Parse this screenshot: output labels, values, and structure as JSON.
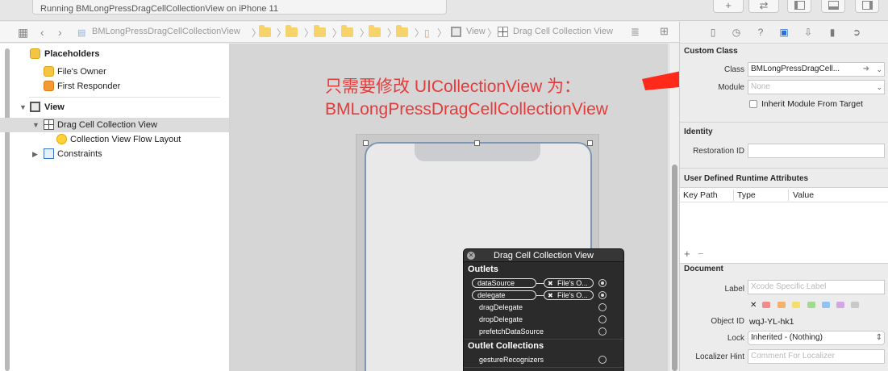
{
  "toolbar": {
    "activity_text": "Running BMLongPressDragCellCollectionView on iPhone 11",
    "add_icon": "+",
    "swap_icon": "⇄"
  },
  "jumpbar": {
    "project": "BMLongPressDragCellCollectionView",
    "view": "View",
    "collection": "Drag Cell Collection View"
  },
  "outline": {
    "placeholders": "Placeholders",
    "files_owner": "File's Owner",
    "first_responder": "First Responder",
    "view": "View",
    "drag_cell_collection_view": "Drag Cell Collection View",
    "flow_layout": "Collection View Flow Layout",
    "constraints": "Constraints"
  },
  "annotation": {
    "line1": "只需要修改 UICollectionView 为：",
    "line2": "BMLongPressDragCellCollectionView",
    "color": "#e53b3b"
  },
  "popup": {
    "title": "Drag Cell Collection View",
    "outlets_header": "Outlets",
    "outlets": [
      {
        "name": "dataSource",
        "target": "File's O...",
        "connected": true
      },
      {
        "name": "delegate",
        "target": "File's O...",
        "connected": true
      },
      {
        "name": "dragDelegate",
        "connected": false
      },
      {
        "name": "dropDelegate",
        "connected": false
      },
      {
        "name": "prefetchDataSource",
        "connected": false
      }
    ],
    "collections_header": "Outlet Collections",
    "collections": [
      {
        "name": "gestureRecognizers",
        "connected": false
      }
    ]
  },
  "inspector": {
    "custom_class": {
      "header": "Custom Class",
      "class_label": "Class",
      "class_value": "BMLongPressDragCell...",
      "module_label": "Module",
      "module_placeholder": "None",
      "inherit_label": "Inherit Module From Target",
      "inherit_checked": false
    },
    "identity": {
      "header": "Identity",
      "restoration_label": "Restoration ID",
      "restoration_value": ""
    },
    "runtime": {
      "header": "User Defined Runtime Attributes",
      "col_key_path": "Key Path",
      "col_type": "Type",
      "col_value": "Value",
      "plus": "+",
      "minus": "−"
    },
    "document": {
      "header": "Document",
      "label_label": "Label",
      "label_placeholder": "Xcode Specific Label",
      "clear_icon": "✕",
      "label_colors": [
        "#f08c8c",
        "#f3b26b",
        "#f5dd6a",
        "#9fdc8f",
        "#8ec3f3",
        "#d3a7e6",
        "#c8c8c8"
      ],
      "object_id_label": "Object ID",
      "object_id_value": "wqJ-YL-hk1",
      "lock_label": "Lock",
      "lock_value": "Inherited - (Nothing)",
      "localizer_label": "Localizer Hint",
      "localizer_placeholder": "Comment For Localizer"
    }
  },
  "accent_color": "#2d6fd6",
  "arrow_color": "#ff2a1a"
}
